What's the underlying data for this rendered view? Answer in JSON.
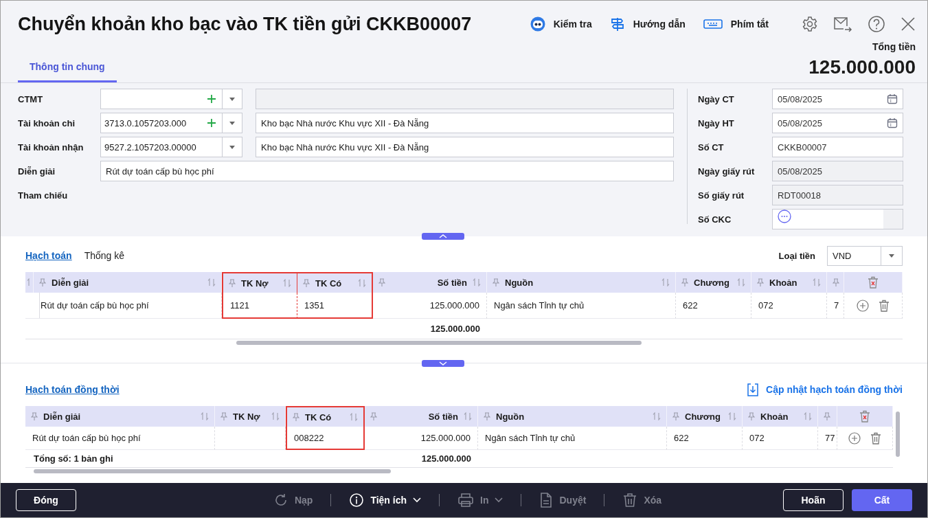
{
  "window": {
    "title": "Chuyển khoản kho bạc vào TK tiền gửi CKKB00007"
  },
  "toolbar": [
    {
      "label": "Kiểm tra",
      "kind": "check"
    },
    {
      "label": "Hướng dẫn",
      "kind": "guide"
    },
    {
      "label": "Phím tắt",
      "kind": "keys"
    }
  ],
  "tabs": [
    {
      "label": "Thông tin chung",
      "selected": true
    }
  ],
  "total": {
    "label": "Tổng tiền",
    "value": "125.000.000"
  },
  "left_fields": [
    {
      "label": "CTMT",
      "kind": "combo",
      "add": true,
      "detail": {
        "disabled": true
      }
    },
    {
      "label": "Tài khoản chi",
      "kind": "combo",
      "value": "3713.0.1057203.000",
      "add": true,
      "detail": {
        "value": "Kho bạc Nhà nước Khu vực XII - Đà Nẵng",
        "disabled": false
      }
    },
    {
      "label": "Tài khoản nhận",
      "kind": "combo",
      "value": "9527.2.1057203.00000",
      "add": false,
      "detail": {
        "value": "Kho bạc Nhà nước Khu vực XII - Đà Nẵng",
        "disabled": false
      }
    },
    {
      "label": "Diễn giải",
      "kind": "text",
      "value": "Rút dự toán cấp bù học phí"
    },
    {
      "label": "Tham chiếu",
      "kind": "none"
    }
  ],
  "right_fields": [
    {
      "label": "Ngày CT",
      "kind": "date",
      "value": "05/08/2025",
      "disabled": false
    },
    {
      "label": "Ngày HT",
      "kind": "date",
      "value": "05/08/2025",
      "disabled": false
    },
    {
      "label": "Số CT",
      "kind": "text",
      "value": "CKKB00007",
      "disabled": false
    },
    {
      "label": "Ngày giấy rút",
      "kind": "text",
      "value": "05/08/2025",
      "disabled": true
    },
    {
      "label": "Số giấy rút",
      "kind": "text",
      "value": "RDT00018",
      "disabled": true
    },
    {
      "label": "Số CKC",
      "kind": "more",
      "disabled": false
    }
  ],
  "accounting": {
    "tabs": [
      {
        "label": "Hạch toán",
        "selected": true
      },
      {
        "label": "Thống kê",
        "selected": false
      }
    ],
    "currency": {
      "label": "Loại tiền",
      "value": "VND"
    },
    "columns": [
      {
        "label": "Diễn giải",
        "highlighted": false
      },
      {
        "label": "TK Nợ",
        "highlighted": true
      },
      {
        "label": "TK Có",
        "highlighted": true
      },
      {
        "label": "Số tiền",
        "highlighted": false,
        "total": "125.000.000"
      },
      {
        "label": "Nguồn",
        "highlighted": false
      },
      {
        "label": "Chương",
        "highlighted": false
      },
      {
        "label": "Khoản",
        "highlighted": false
      },
      {
        "highlighted": false
      }
    ],
    "rows": [
      {
        "description": "Rút dự toán cấp bù học phí",
        "debit": "1121",
        "credit": "1351",
        "amount": "125.000.000",
        "source": "Ngân sách Tỉnh tự chủ",
        "chapter": "622",
        "item": "072",
        "column_8": "7"
      }
    ]
  },
  "concurrent": {
    "tabs": [
      {
        "label": "Hạch toán đồng thời",
        "selected": true
      }
    ],
    "update_link": "Cập nhật hạch toán đồng thời",
    "columns": [
      {
        "label": "Diễn giải",
        "highlighted": false,
        "total": "Tổng số: **1** bản ghi"
      },
      {
        "label": "TK Nợ",
        "highlighted": false
      },
      {
        "label": "TK Có",
        "highlighted": true
      },
      {
        "label": "Số tiền",
        "highlighted": false,
        "total": "125.000.000"
      },
      {
        "label": "Nguồn",
        "highlighted": false
      },
      {
        "label": "Chương",
        "highlighted": false
      },
      {
        "label": "Khoản",
        "highlighted": false
      },
      {
        "highlighted": false
      }
    ],
    "rows": [
      {
        "description": "Rút dự toán cấp bù học phí",
        "credit": "008222",
        "amount": "125.000.000",
        "source": "Ngân sách Tỉnh tự chủ",
        "chapter": "622",
        "item": "072",
        "column_8": "77"
      }
    ]
  },
  "footer": {
    "left": [
      {
        "label": "Đóng",
        "kind": "outline"
      }
    ],
    "tools": [
      {
        "label": "Nạp",
        "kind": "refresh",
        "disabled": true,
        "caret": false
      },
      {
        "label": "Tiện ích",
        "kind": "info",
        "disabled": false,
        "caret": true
      },
      {
        "label": "In",
        "kind": "printer",
        "disabled": true,
        "caret": true
      },
      {
        "label": "Duyệt",
        "kind": "document",
        "disabled": true,
        "caret": false
      },
      {
        "label": "Xóa",
        "kind": "trash",
        "disabled": true,
        "caret": false
      }
    ],
    "right": [
      {
        "label": "Hoãn",
        "kind": "outline"
      },
      {
        "label": "Cất",
        "kind": "primary"
      }
    ]
  }
}
